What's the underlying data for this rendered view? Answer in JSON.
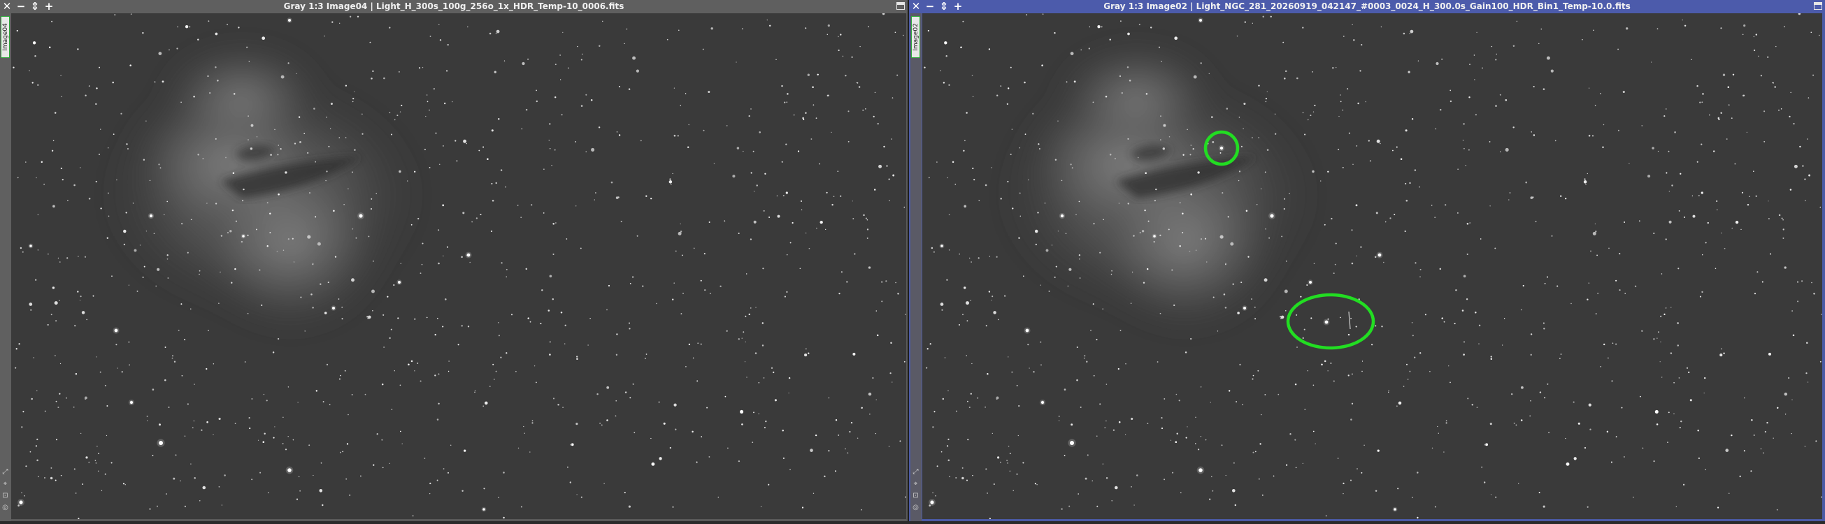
{
  "left_window": {
    "title": "Gray 1:3 Image04 | Light_H_300s_100g_256o_1x_HDR_Temp-10_0006.fits",
    "view_tab": "Image04",
    "close_icon": "close-icon",
    "minimize_icon": "minimize-icon",
    "shade_icon": "shade-icon",
    "maximize_icon": "maximize-icon",
    "active": false
  },
  "right_window": {
    "title": "Gray 1:3 Image02 | Light_NGC_281_20260919_042147_#0003_0024_H_300.0s_Gain100_HDR_Bin1_Temp-10.0.fits",
    "view_tab": "Image02",
    "close_icon": "close-icon",
    "minimize_icon": "minimize-icon",
    "shade_icon": "shade-icon",
    "maximize_icon": "maximize-icon",
    "active": true,
    "annotations": [
      {
        "shape": "circle",
        "color": "#22dd22",
        "marks": "bright star"
      },
      {
        "shape": "ellipse",
        "color": "#22dd22",
        "marks": "star with streak"
      }
    ]
  },
  "colors": {
    "active_title": "#4c5bab",
    "inactive_title": "#5f5f5f",
    "annotation": "#22dd22",
    "sky_background": "#3a3a3a"
  }
}
